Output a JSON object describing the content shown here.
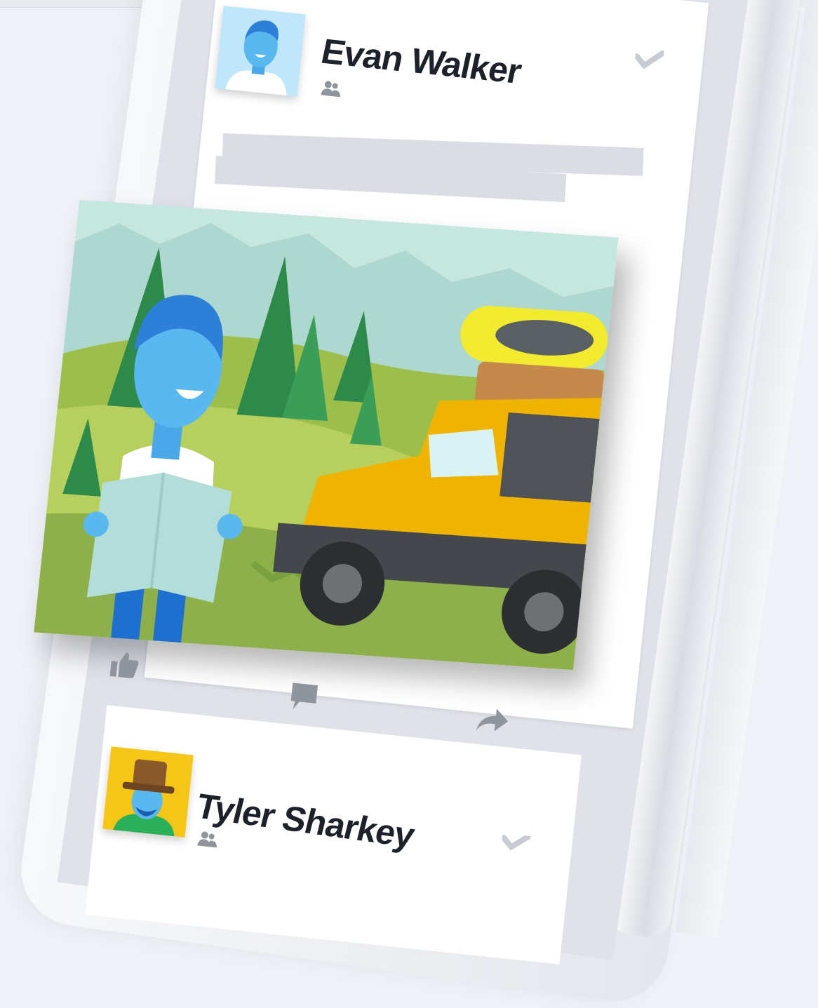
{
  "feed": {
    "posts": [
      {
        "author": "Evan Walker",
        "audience_icon": "friends-icon",
        "menu_icon": "chevron-down-icon",
        "has_photo": true,
        "actions": [
          {
            "icon": "like-icon"
          },
          {
            "icon": "comment-icon"
          },
          {
            "icon": "share-icon"
          }
        ]
      },
      {
        "author": "Tyler Sharkey",
        "audience_icon": "friends-icon",
        "menu_icon": "chevron-down-icon"
      }
    ]
  },
  "colors": {
    "background": "#eef1f6",
    "card": "#ffffff",
    "placeholder_line": "#dadde3",
    "name_text": "#1d2129",
    "icon_gray": "#90949c",
    "avatar_blue": "#5ab8f0",
    "avatar_yellow": "#f5c518"
  }
}
